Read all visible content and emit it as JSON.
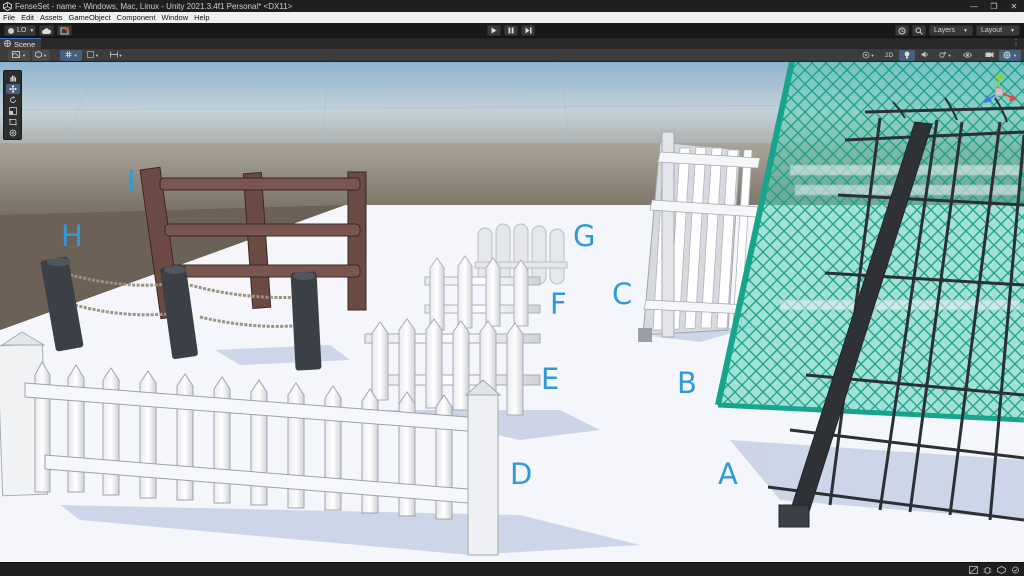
{
  "window": {
    "title": "FenseSet - name - Windows, Mac, Linux - Unity 2021.3.4f1 Personal* <DX11>"
  },
  "menu": {
    "items": [
      "File",
      "Edit",
      "Assets",
      "GameObject",
      "Component",
      "Window",
      "Help"
    ]
  },
  "toolbar": {
    "account_label": "LO",
    "layers_label": "Layers",
    "layout_label": "Layout"
  },
  "scene_tab": {
    "label": "Scene"
  },
  "scene_toolbar": {
    "mode_2d_label": "2D"
  },
  "scene_labels": {
    "A": "A",
    "B": "B",
    "C": "C",
    "D": "D",
    "E": "E",
    "F": "F",
    "G": "G",
    "H": "H",
    "I": "I"
  },
  "colors": {
    "label_blue": "#2f9ad8",
    "accent": "#46607c",
    "chainlink": "#20b0a0"
  },
  "icons": {
    "tools": [
      "hand-tool-icon",
      "move-tool-icon",
      "rotate-tool-icon",
      "scale-tool-icon",
      "rect-tool-icon",
      "transform-tool-icon"
    ]
  }
}
